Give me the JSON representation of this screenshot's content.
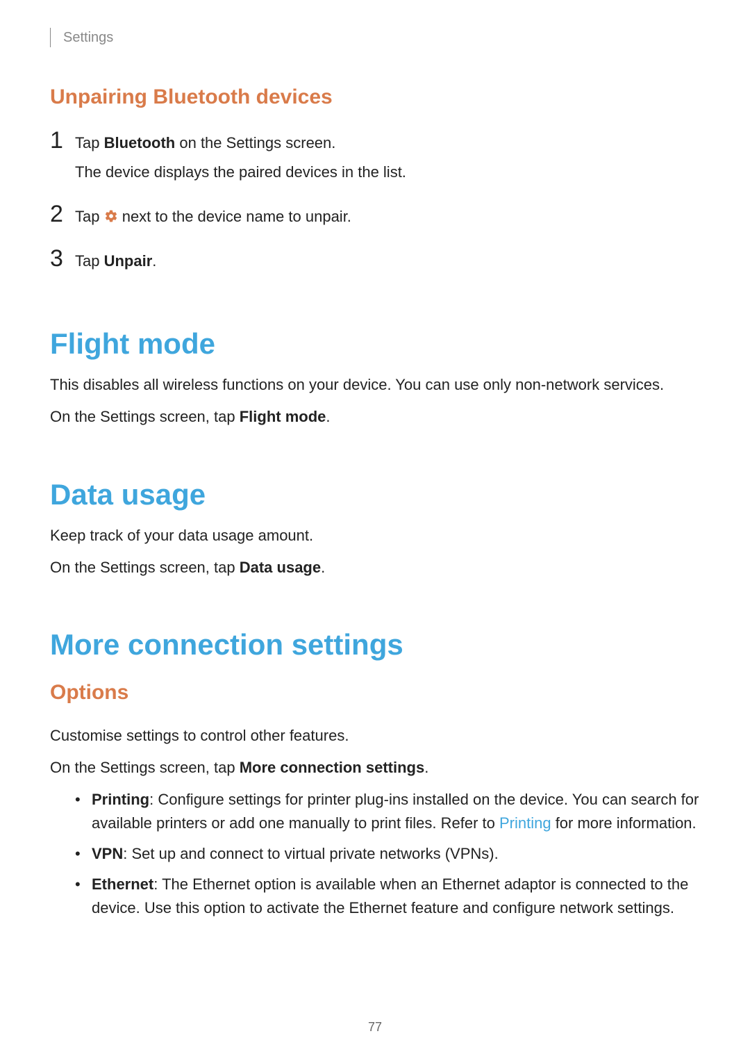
{
  "headerLabel": "Settings",
  "unpair": {
    "heading": "Unpairing Bluetooth devices",
    "steps": [
      {
        "num": "1",
        "line1_pre": "Tap ",
        "line1_bold": "Bluetooth",
        "line1_post": " on the Settings screen.",
        "line2": "The device displays the paired devices in the list."
      },
      {
        "num": "2",
        "line1_pre": "Tap ",
        "line1_post": " next to the device name to unpair."
      },
      {
        "num": "3",
        "line1_pre": "Tap ",
        "line1_bold": "Unpair",
        "line1_post": "."
      }
    ]
  },
  "flight": {
    "heading": "Flight mode",
    "p1": "This disables all wireless functions on your device. You can use only non-network services.",
    "p2_pre": "On the Settings screen, tap ",
    "p2_bold": "Flight mode",
    "p2_post": "."
  },
  "dataUsage": {
    "heading": "Data usage",
    "p1": "Keep track of your data usage amount.",
    "p2_pre": "On the Settings screen, tap ",
    "p2_bold": "Data usage",
    "p2_post": "."
  },
  "more": {
    "heading": "More connection settings",
    "sub": "Options",
    "p1": "Customise settings to control other features.",
    "p2_pre": "On the Settings screen, tap ",
    "p2_bold": "More connection settings",
    "p2_post": ".",
    "bullets": [
      {
        "bold": "Printing",
        "text1": ": Configure settings for printer plug-ins installed on the device. You can search for available printers or add one manually to print files. Refer to ",
        "link": "Printing",
        "text2": " for more information."
      },
      {
        "bold": "VPN",
        "text1": ": Set up and connect to virtual private networks (VPNs)."
      },
      {
        "bold": "Ethernet",
        "text1": ": The Ethernet option is available when an Ethernet adaptor is connected to the device. Use this option to activate the Ethernet feature and configure network settings."
      }
    ]
  },
  "pageNumber": "77"
}
